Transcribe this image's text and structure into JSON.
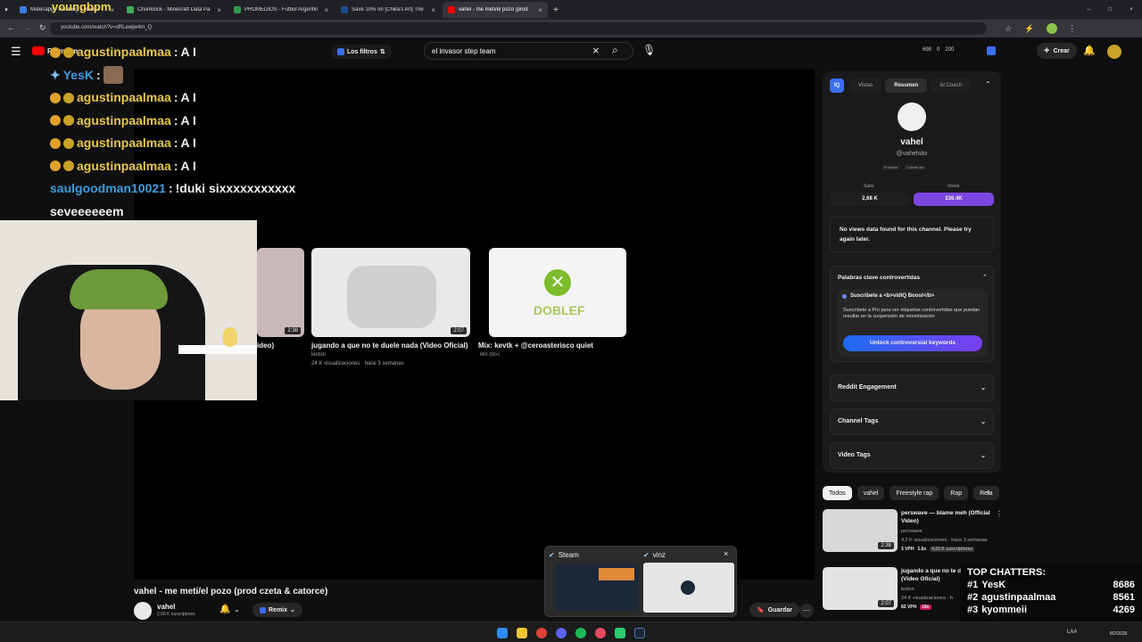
{
  "browser": {
    "tabs": [
      {
        "title": "Matecapp - Ranking y Radio",
        "color": "#3b7be0"
      },
      {
        "title": "Chunklock - Minecraft Data Pa",
        "color": "#3fae5a"
      },
      {
        "title": "PROMEDIOS - Futbol Argentin",
        "color": "#2e9c48"
      },
      {
        "title": "Save 10% on [Chilla's Art] The",
        "color": "#1b4b8a"
      },
      {
        "title": "vahel - me meti/el pozo (prod",
        "color": "#ff0000",
        "active": true
      }
    ],
    "url": "youtube.com/watch?v=oRLewjw4m_Q"
  },
  "youtube": {
    "logo_label": "Premium",
    "filter_label": "Los filtros",
    "search_value": "el invasor step team",
    "stats": {
      "a": "698",
      "b": "0",
      "c": "200"
    },
    "create_label": "Crear"
  },
  "chat_overlay": {
    "top_user": "youngbpm",
    "lines": [
      {
        "user": "YesK",
        "msg": ""
      },
      {
        "user": "agustinpaalmaa",
        "msg": "A I"
      },
      {
        "user": "YesK",
        "msg": ""
      },
      {
        "user": "agustinpaalmaa",
        "msg": "A I"
      },
      {
        "user": "agustinpaalmaa",
        "msg": "A I"
      },
      {
        "user": "agustinpaalmaa",
        "msg": "A I"
      },
      {
        "user": "agustinpaalmaa",
        "msg": "A I"
      }
    ],
    "last_user": "saulgoodman10021",
    "last_msg": "!duki sixxxxxxxxxxx",
    "last_msg2": "seveeeeeem"
  },
  "end_screen": {
    "videos": [
      {
        "title": "ideo)",
        "duration": "2:38"
      },
      {
        "title": "jugando a que no te duele nada (Video Oficial)",
        "channel": "leston",
        "meta": "24 K visualizaciones · hace 3 semanas",
        "duration": "2:07"
      },
      {
        "title": "Mix: kevtk + @ceroasterisco quiet",
        "meta": "MIX (50+)",
        "logo_text": "DOBLEF"
      }
    ]
  },
  "video": {
    "title": "vahel - me meti/el pozo (prod czeta & catorce)",
    "channel": "vahel",
    "subs": "2,68 K suscriptores",
    "remix_label": "Remix",
    "save_label": "Guardar"
  },
  "vidiq": {
    "tabs": [
      "Vistas",
      "Resumen",
      "AI Coach"
    ],
    "channel_name": "vahel",
    "handle": "@vahelsito",
    "small_stats": [
      "8 videos",
      "2 years old"
    ],
    "subs_label": "Subs",
    "subs_value": "2,68 K",
    "views_label": "Views",
    "views_value": "236.4K",
    "no_data": "No views data found for this channel. Please try again later.",
    "controversial": {
      "title": "Palabras clave controvertidas",
      "promo": "Suscríbete a <b>vidIQ Boost</b>",
      "desc": "Suscríbete a Pro para ver etiquetas controvertidas que puedan resultar en la suspensión de monetización",
      "button": "Unlock controversial keywords"
    },
    "sections": [
      "Reddit Engagement",
      "Channel Tags",
      "Video Tags"
    ]
  },
  "chips": [
    "Todos",
    "vahel",
    "Freestyle rap",
    "Rap",
    "Rela"
  ],
  "related": [
    {
      "title": "perswave — blame meh (Official Video)",
      "channel": "perswave",
      "meta": "4,2 K visualizaciones · hace 3 semanas",
      "duration": "2:38",
      "vph": "3 VPH",
      "mult": "1.6x",
      "subs": "4,02 K suscriptores"
    },
    {
      "title": "jugando a que no te d (Video Oficial)",
      "channel": "leston",
      "meta": "24 K visualizaciones · h",
      "duration": "2:07",
      "vph": "82 VPH",
      "mult": "19x"
    }
  ],
  "top_chatters": {
    "title": "TOP CHATTERS:",
    "rows": [
      {
        "rank": "#1",
        "user": "YesK",
        "count": "8686"
      },
      {
        "rank": "#2",
        "user": "agustinpaalmaa",
        "count": "8561"
      },
      {
        "rank": "#3",
        "user": "kyommeii",
        "count": "4269"
      }
    ]
  },
  "popup": {
    "left": "Steam",
    "right": "vinz"
  },
  "taskbar": {
    "lang": "LAA",
    "date": "8/2/2026"
  }
}
